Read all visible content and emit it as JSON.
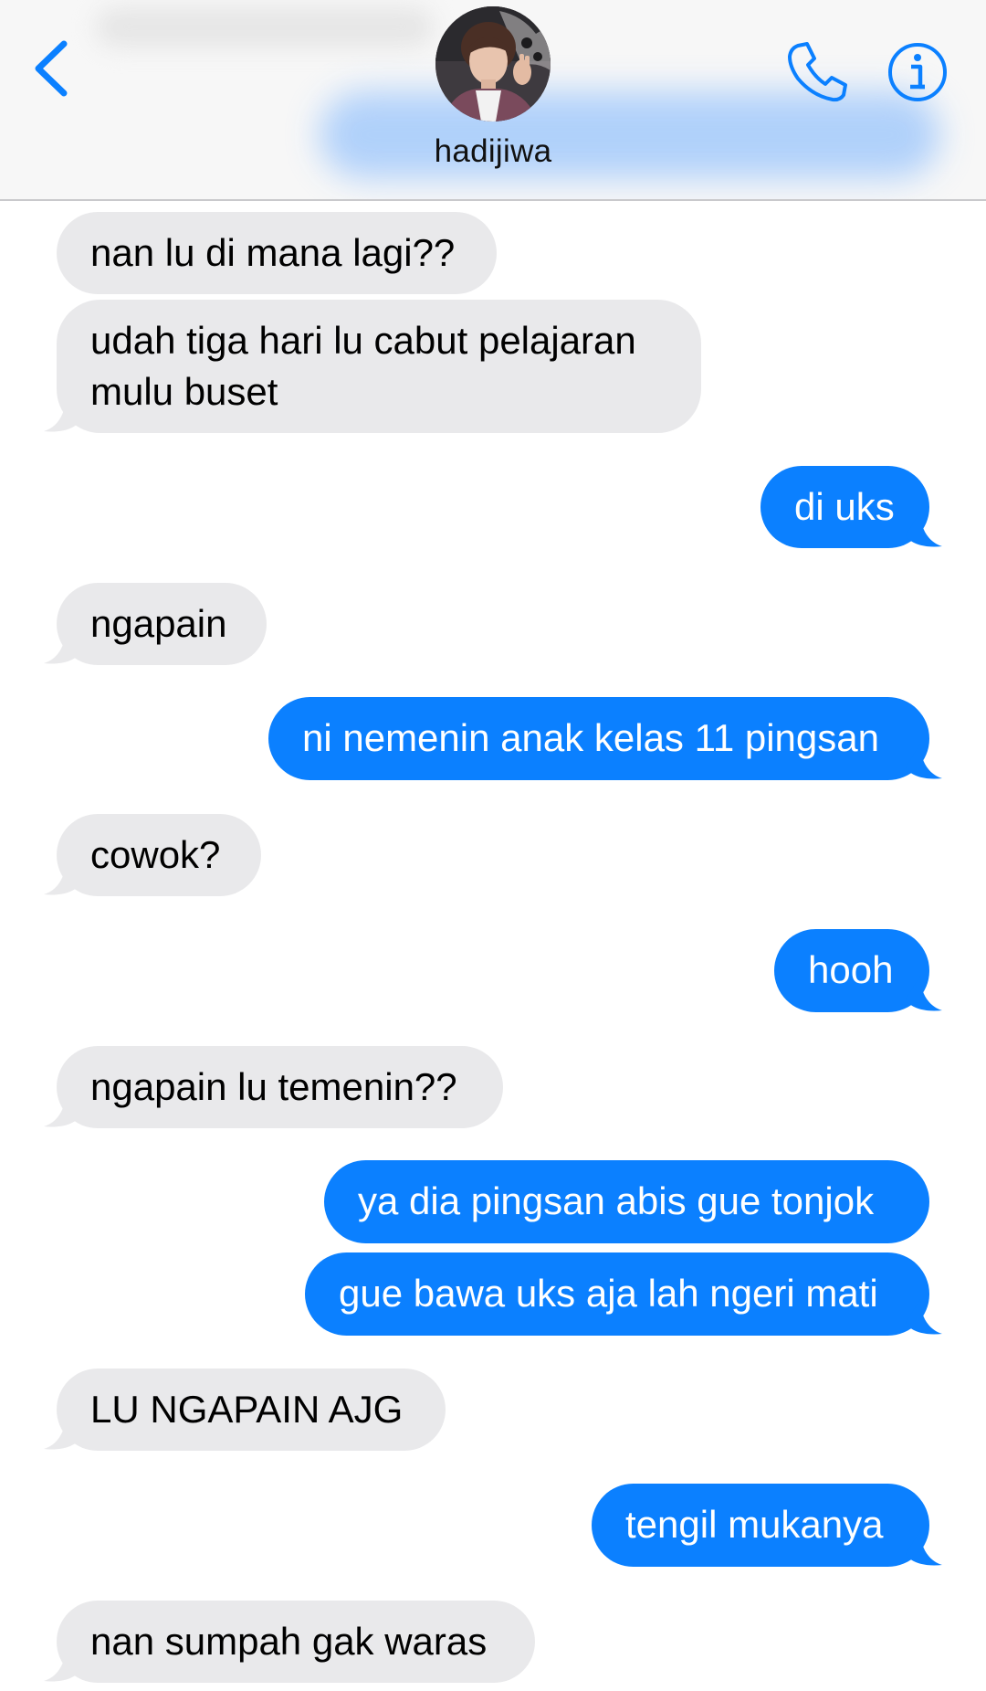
{
  "header": {
    "contact_name": "hadijiwa",
    "back_icon": "chevron-left-icon",
    "call_icon": "phone-icon",
    "info_icon": "info-icon",
    "accent_color": "#0b80ff"
  },
  "messages": [
    {
      "direction": "incoming",
      "text": "nan lu di mana lagi??"
    },
    {
      "direction": "incoming",
      "text_lines": [
        "udah tiga hari lu cabut pelajaran",
        "mulu buset"
      ]
    },
    {
      "direction": "outgoing",
      "text": "di uks"
    },
    {
      "direction": "incoming",
      "text": "ngapain"
    },
    {
      "direction": "outgoing",
      "text": "ni nemenin anak kelas 11 pingsan"
    },
    {
      "direction": "incoming",
      "text": "cowok?"
    },
    {
      "direction": "outgoing",
      "text": "hooh"
    },
    {
      "direction": "incoming",
      "text": "ngapain lu temenin??"
    },
    {
      "direction": "outgoing",
      "text": "ya dia pingsan abis gue tonjok"
    },
    {
      "direction": "outgoing",
      "text": "gue bawa uks aja lah ngeri mati"
    },
    {
      "direction": "incoming",
      "text": "LU NGAPAIN AJG"
    },
    {
      "direction": "outgoing",
      "text": "tengil mukanya"
    },
    {
      "direction": "incoming",
      "text": "nan sumpah gak waras"
    }
  ],
  "colors": {
    "incoming_bubble": "#e9e9eb",
    "outgoing_bubble": "#0b80ff"
  }
}
